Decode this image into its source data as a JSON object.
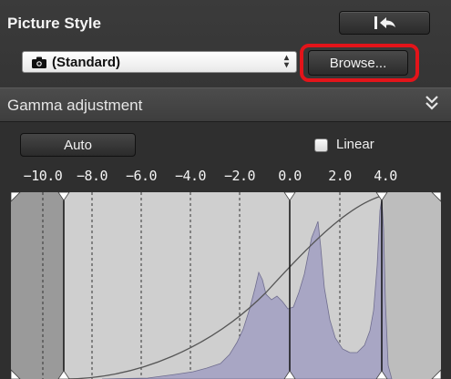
{
  "picture_style": {
    "title": "Picture Style",
    "reset_icon": "revert-to-start-icon",
    "selected_style": "(Standard)",
    "style_icon": "camera-icon",
    "browse_label": "Browse...",
    "highlight_color": "#e3141a"
  },
  "gamma": {
    "title": "Gamma adjustment",
    "collapse_icon": "double-chevron-down-icon",
    "auto_label": "Auto",
    "linear_label": "Linear",
    "linear_checked": false,
    "axis_ticks": [
      "−10.0",
      "−8.0",
      "−6.0",
      "−4.0",
      "−2.0",
      "0.0",
      "2.0",
      "4.0"
    ],
    "handles": {
      "shadow_point": -8.0,
      "midpoint": 0.0,
      "highlight_point": 4.0
    },
    "histogram_color": "#a8a6c4",
    "background_color": "#cfcfcf",
    "clipped_shade_color": "#9a9a9a"
  }
}
